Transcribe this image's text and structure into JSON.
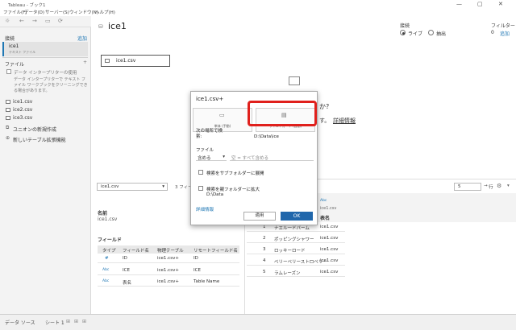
{
  "window": {
    "title": "Tableau - ブック1",
    "controls": [
      "—",
      "▢",
      "✕"
    ]
  },
  "menu": [
    "ファイル(F)",
    "データ(D)",
    "サーバー(S)",
    "ウィンドウ(N)",
    "ヘルプ(H)"
  ],
  "toolbar": {
    "icons": [
      "☼",
      "←",
      "→",
      "▭",
      "⟳"
    ]
  },
  "left": {
    "connections_label": "接続",
    "add_label": "追加",
    "connection": {
      "name": "ice1",
      "subtitle": "テキスト ファイル"
    },
    "files_label": "ファイル",
    "files_toggle": "+",
    "data_interpreter_label": "データ インタープリターの使用",
    "data_interpreter_desc": "データ インタープリターで テキスト ファイル ワークブックをクリーニングできる場合があります。",
    "files": [
      "ice1.csv",
      "ice2.csv",
      "ice3.csv"
    ],
    "new_union": "ユニオンの新規作成",
    "new_table_ext": "新しいテーブル拡張機能"
  },
  "canvas": {
    "title": "ice1",
    "table_box": "ice1.csv",
    "connection_label": "接続",
    "live": "ライブ",
    "extract": "抽出",
    "filter_label": "フィルター",
    "filter_count": "0",
    "add_label": "追加",
    "behind_text_1": "か?",
    "behind_text_2": "す。",
    "behind_link": "詳細情報"
  },
  "lower": {
    "table_select": "ice1.csv",
    "fields_count": "3 フィー",
    "name_label": "名前",
    "name_value": "ice1.csv",
    "fields_label": "フィールド",
    "fields_columns": [
      "タイプ",
      "フィールド名",
      "物理テーブル",
      "リモートフィールド名"
    ],
    "fields_rows": [
      {
        "type": "#",
        "name": "ID",
        "table": "ice1.csv+",
        "remote": "ID"
      },
      {
        "type": "Abc",
        "name": "ICE",
        "table": "ice1.csv+",
        "remote": "ICE"
      },
      {
        "type": "Abc",
        "name": "表名",
        "table": "ice1.csv+",
        "remote": "Table Name"
      }
    ],
    "rows_value": "5",
    "rows_unit": "行",
    "grid_header_type": "Abc",
    "grid_header_sub": "ice1.csv",
    "grid_header_name": "表名",
    "grid_rows": [
      {
        "n": "1",
        "ice": "ナエル一ドバーム",
        "table": "ice1.csv"
      },
      {
        "n": "2",
        "ice": "ポッピングシャワー",
        "table": "ice1.csv"
      },
      {
        "n": "3",
        "ice": "ロッキーロード",
        "table": "ice1.csv"
      },
      {
        "n": "4",
        "ice": "ベリーベリーストロベリー",
        "table": "ice1.csv"
      },
      {
        "n": "5",
        "ice": "ラムレーズン",
        "table": "ice1.csv"
      }
    ]
  },
  "dialog": {
    "title": "ice1.csv+",
    "option_single": "単体 (手動)",
    "option_wildcard": "ワイルドカード (自動)",
    "search_label": "次の場所で検索:",
    "search_path": "D:\\Data\\ice",
    "file_label": "ファイル",
    "match_select": "含める",
    "match_placeholder": "空 = すべて含める",
    "subfolder_check": "検索をサブフォルダーに展開",
    "parent_check": "検索を親フォルダーに拡大",
    "parent_path": "D:\\Data",
    "details_link": "詳細情報",
    "apply": "適用",
    "ok": "OK"
  },
  "statusbar": {
    "datasource": "データ ソース",
    "sheet": "シート 1"
  },
  "colors": {
    "accent": "#1f77b4",
    "ok_button": "#2167ab",
    "highlight": "#e0201c"
  }
}
